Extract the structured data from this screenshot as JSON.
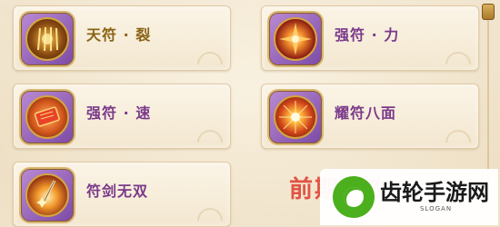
{
  "skills": [
    {
      "label": "天符 · 裂",
      "icon": "shredded-talisman-icon",
      "color": "#8a6414"
    },
    {
      "label": "强符 · 力",
      "icon": "power-burst-icon",
      "color": "#7a3a8a"
    },
    {
      "label": "强符 · 速",
      "icon": "speed-talisman-icon",
      "color": "#7a3a8a"
    },
    {
      "label": "耀符八面",
      "icon": "radiant-sun-icon",
      "color": "#7a3a8a"
    },
    {
      "label": "符剑无双",
      "icon": "sword-talisman-icon",
      "color": "#7a3a8a"
    }
  ],
  "overlay_text": "前期氪攻",
  "watermark": {
    "name": "齿轮手游网",
    "slogan": "SLOGAN"
  }
}
